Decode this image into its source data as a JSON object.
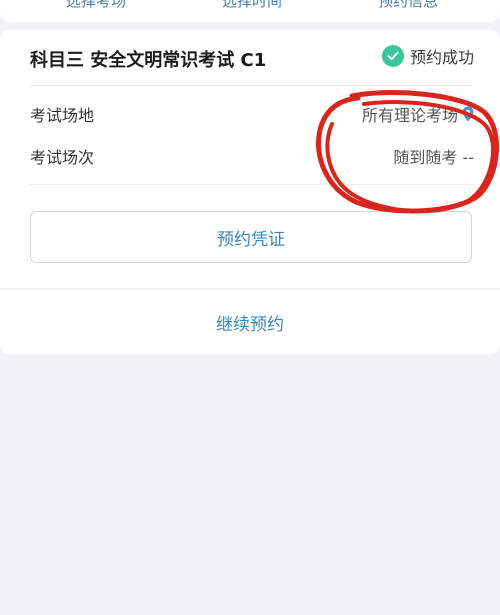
{
  "steps": [
    "选择考场",
    "选择时间",
    "预约信息"
  ],
  "card": {
    "title": "科目三 安全文明常识考试 C1",
    "status": "预约成功",
    "rows": [
      {
        "label": "考试场地",
        "value": "所有理论考场",
        "icon": "location-pin-icon"
      },
      {
        "label": "考试场次",
        "value": "随到随考 --"
      }
    ],
    "voucher_button": "预约凭证"
  },
  "continue_label": "继续预约",
  "colors": {
    "accent": "#3a86b9",
    "success": "#3cc79b",
    "annotation": "#d9261c",
    "background": "#f2f1f6"
  }
}
